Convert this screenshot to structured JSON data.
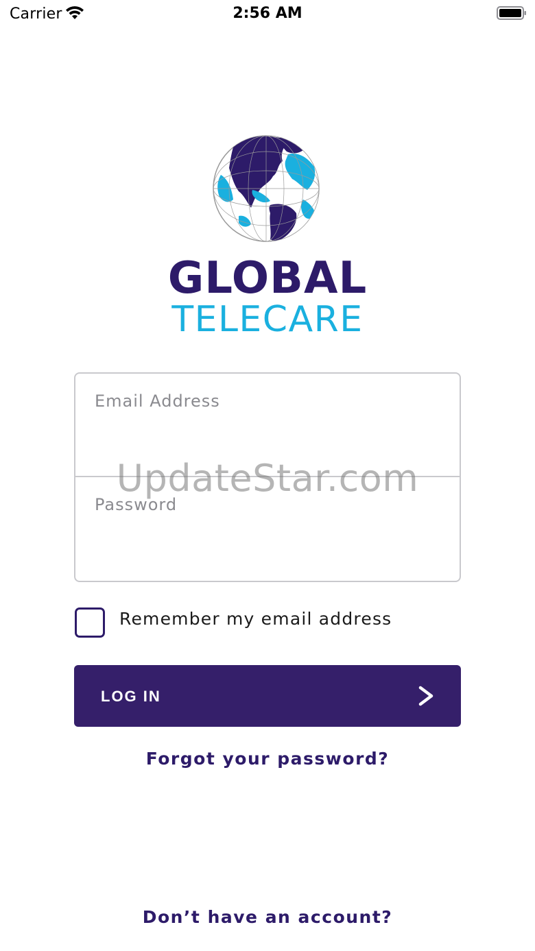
{
  "status_bar": {
    "carrier": "Carrier",
    "time": "2:56 AM"
  },
  "logo": {
    "line1": "GLOBAL",
    "line2": "TELECARE",
    "primary_color": "#2d1b69",
    "secondary_color": "#1ab0df"
  },
  "form": {
    "email_placeholder": "Email Address",
    "email_value": "",
    "password_placeholder": "Password",
    "password_value": ""
  },
  "watermark": "UpdateStar.com",
  "remember": {
    "label": "Remember my email address",
    "checked": false
  },
  "login_button": {
    "label": "LOG IN",
    "icon": "chevron-right-icon",
    "color": "#351f6a"
  },
  "links": {
    "forgot_password": "Forgot your password?",
    "no_account": "Don’t have an account?"
  }
}
